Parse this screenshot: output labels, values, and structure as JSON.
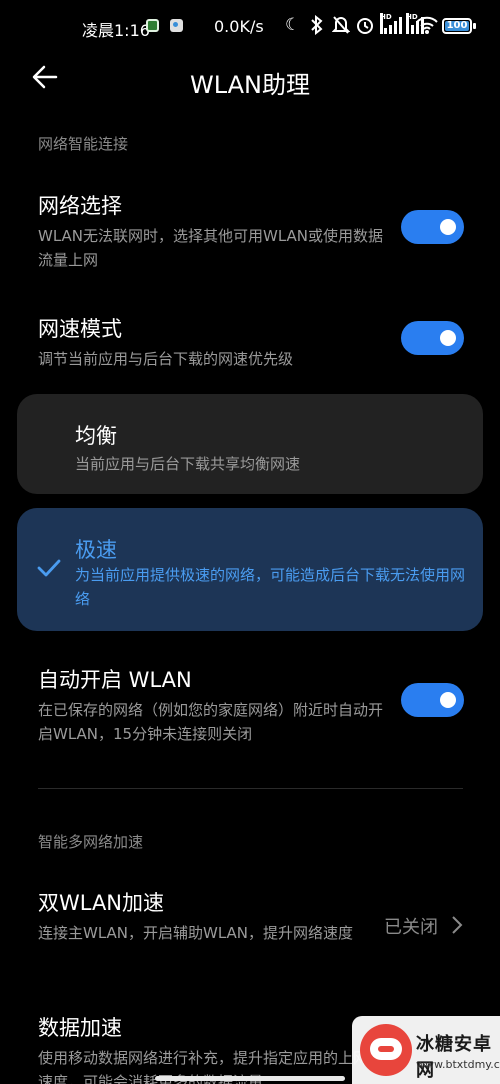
{
  "status_bar": {
    "time": "凌晨1:16",
    "net_speed": "0.0K/s",
    "battery": "100",
    "icons": [
      "moon-icon",
      "bluetooth-icon",
      "mute-bell-icon",
      "alarm-icon",
      "signal-hd-icon",
      "signal-hd-icon",
      "wifi-icon",
      "battery-icon"
    ],
    "hd_label": "HD"
  },
  "header": {
    "title": "WLAN助理",
    "back_icon": "arrow-left-icon"
  },
  "sections": {
    "smart_connect": "网络智能连接",
    "multi_network": "智能多网络加速"
  },
  "network_select": {
    "title": "网络选择",
    "subtitle": "WLAN无法联网时，选择其他可用WLAN或使用数据流量上网",
    "enabled": true
  },
  "speed_mode": {
    "title": "网速模式",
    "subtitle": "调节当前应用与后台下载的网速优先级",
    "enabled": true,
    "options": [
      {
        "title": "均衡",
        "subtitle": "当前应用与后台下载共享均衡网速",
        "selected": false
      },
      {
        "title": "极速",
        "subtitle": "为当前应用提供极速的网络，可能造成后台下载无法使用网络",
        "selected": true
      }
    ]
  },
  "auto_wlan": {
    "title": "自动开启 WLAN",
    "subtitle": "在已保存的网络（例如您的家庭网络）附近时自动开启WLAN，15分钟未连接则关闭",
    "enabled": true
  },
  "dual_wlan": {
    "title": "双WLAN加速",
    "subtitle": "连接主WLAN，开启辅助WLAN，提升网络速度",
    "value": "已关闭"
  },
  "data_boost": {
    "title": "数据加速",
    "subtitle": "使用移动数据网络进行补充，提升指定应用的上网速度，可能会消耗更多的数据流量"
  },
  "watermark": {
    "name": "冰糖安卓网",
    "url": "www.btxtdmy.com"
  },
  "colors": {
    "accent": "#2a7ef0",
    "selected_card": "#1d3556",
    "plain_card": "#222222",
    "selected_text": "#4a9cf0"
  }
}
